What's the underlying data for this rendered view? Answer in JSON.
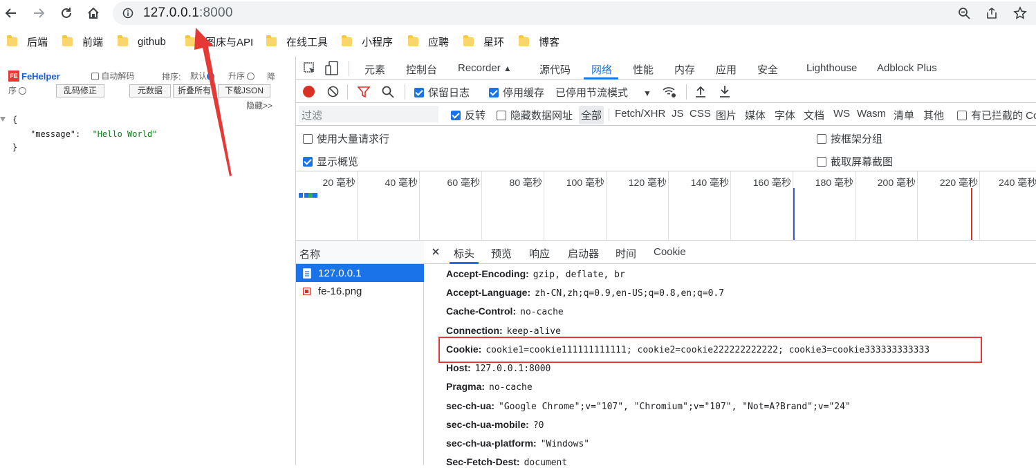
{
  "browser": {
    "url_host": "127.0.0.1",
    "url_port": ":8000",
    "bookmarks": [
      "后端",
      "前端",
      "github",
      "图床与API",
      "在线工具",
      "小程序",
      "应聘",
      "星环",
      "博客"
    ]
  },
  "fehelper": {
    "title": "FeHelper",
    "auto_decode": "自动解码",
    "sort_label": "排序:",
    "sort_default": "默认",
    "sort_asc": "升序",
    "sort_desc_1": "降",
    "sort_desc_2": "序",
    "btn_fix": "乱码修正",
    "btn_meta": "元数据",
    "btn_fold": "折叠所有",
    "btn_download": "下载JSON",
    "hide": "隐藏>>",
    "json_open": "{",
    "json_key": "\"message\":",
    "json_value": "\"Hello World\"",
    "json_close": "}"
  },
  "devtools": {
    "tabs": [
      "元素",
      "控制台",
      "Recorder",
      "源代码",
      "网络",
      "性能",
      "内存",
      "应用",
      "安全",
      "Lighthouse",
      "Adblock Plus"
    ],
    "active_tab": "网络",
    "toolbar": {
      "preserve_log": "保留日志",
      "disable_cache": "停用缓存",
      "throttling": "已停用节流模式"
    },
    "filter": {
      "placeholder": "过滤",
      "invert": "反转",
      "hide_data_urls": "隐藏数据网址",
      "types": [
        "全部",
        "Fetch/XHR",
        "JS",
        "CSS",
        "图片",
        "媒体",
        "字体",
        "文档",
        "WS",
        "Wasm",
        "清单",
        "其他"
      ],
      "blocked_cookies": "有已拦截的 Co"
    },
    "settings": {
      "large_rows": "使用大量请求行",
      "group_by_frame": "按框架分组",
      "show_overview": "显示概览",
      "capture_screenshots": "截取屏幕截图"
    },
    "timeline_ticks": [
      "20 毫秒",
      "40 毫秒",
      "60 毫秒",
      "80 毫秒",
      "100 毫秒",
      "120 毫秒",
      "140 毫秒",
      "160 毫秒",
      "180 毫秒",
      "200 毫秒",
      "220 毫秒",
      "240 毫秒"
    ],
    "requests": {
      "header": "名称",
      "items": [
        "127.0.0.1",
        "fe-16.png"
      ]
    },
    "detail_tabs": [
      "标头",
      "预览",
      "响应",
      "启动器",
      "时间",
      "Cookie"
    ],
    "headers": [
      {
        "name": "Accept-Encoding:",
        "value": "gzip, deflate, br"
      },
      {
        "name": "Accept-Language:",
        "value": "zh-CN,zh;q=0.9,en-US;q=0.8,en;q=0.7"
      },
      {
        "name": "Cache-Control:",
        "value": "no-cache"
      },
      {
        "name": "Connection:",
        "value": "keep-alive"
      },
      {
        "name": "Cookie:",
        "value": "cookie1=cookie111111111111; cookie2=cookie222222222222; cookie3=cookie333333333333"
      },
      {
        "name": "Host:",
        "value": "127.0.0.1:8000"
      },
      {
        "name": "Pragma:",
        "value": "no-cache"
      },
      {
        "name": "sec-ch-ua:",
        "value": "\"Google Chrome\";v=\"107\", \"Chromium\";v=\"107\", \"Not=A?Brand\";v=\"24\""
      },
      {
        "name": "sec-ch-ua-mobile:",
        "value": "?0"
      },
      {
        "name": "sec-ch-ua-platform:",
        "value": "\"Windows\""
      },
      {
        "name": "Sec-Fetch-Dest:",
        "value": "document"
      }
    ]
  },
  "colors": {
    "accent": "#1a73e8",
    "annotation_red": "#e53935",
    "record_red": "#d93025"
  }
}
